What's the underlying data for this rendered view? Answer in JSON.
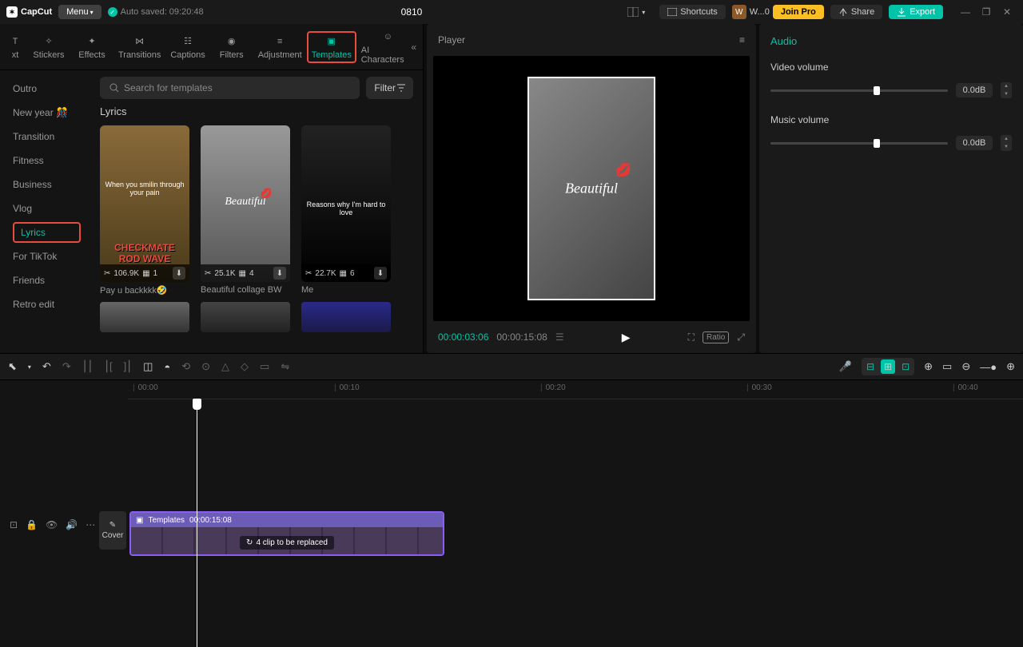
{
  "titlebar": {
    "app_name": "CapCut",
    "menu": "Menu",
    "autosave": "Auto saved: 09:20:48",
    "project_title": "0810",
    "shortcuts": "Shortcuts",
    "user_short": "W...0",
    "join_pro": "Join Pro",
    "share": "Share",
    "export": "Export"
  },
  "top_tabs": {
    "text_partial": "xt",
    "stickers": "Stickers",
    "effects": "Effects",
    "transitions": "Transitions",
    "captions": "Captions",
    "filters": "Filters",
    "adjustment": "Adjustment",
    "templates": "Templates",
    "ai_characters": "AI Characters"
  },
  "categories": {
    "outro": "Outro",
    "newyear": "New year 🎊",
    "transition": "Transition",
    "fitness": "Fitness",
    "business": "Business",
    "vlog": "Vlog",
    "lyrics": "Lyrics",
    "fortiktok": "For TikTok",
    "friends": "Friends",
    "retro": "Retro edit"
  },
  "search": {
    "placeholder": "Search for templates",
    "filter": "Filter"
  },
  "templates_section_title": "Lyrics",
  "templates": [
    {
      "views": "106.9K",
      "pics": "1",
      "name": "Pay u backkkk🤣",
      "overlay1": "When you smilin through your pain",
      "overlay2": "CHECKMATE ROD WAVE"
    },
    {
      "views": "25.1K",
      "pics": "4",
      "name": "Beautiful collage BW",
      "overlay1": "Beautiful"
    },
    {
      "views": "22.7K",
      "pics": "6",
      "name": "Me",
      "overlay1": "Reasons why I'm hard to love"
    }
  ],
  "player": {
    "title": "Player",
    "current": "00:00:03:06",
    "total": "00:00:15:08",
    "ratio": "Ratio",
    "preview_text": "Beautiful"
  },
  "audio_panel": {
    "title": "Audio",
    "video_volume_label": "Video volume",
    "music_volume_label": "Music volume",
    "video_volume_value": "0.0dB",
    "music_volume_value": "0.0dB"
  },
  "timeline": {
    "ticks": [
      "00:00",
      "00:10",
      "00:20",
      "00:30",
      "00:40"
    ],
    "clip_label": "Templates",
    "clip_duration": "00:00:15:08",
    "clip_replace": "4 clip to be replaced",
    "cover": "Cover"
  }
}
